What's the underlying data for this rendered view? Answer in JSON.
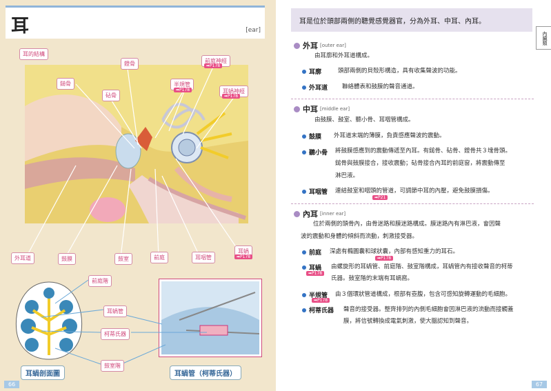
{
  "left": {
    "title": "耳",
    "title_en": "[ear]",
    "structure_title": "耳的結構",
    "labels": {
      "stapes": "鐙骨",
      "vestibular_nerve": "前庭神經",
      "vestibular_ref": "➡P178",
      "hammer": "鎚骨",
      "semicircular": "半規管",
      "semicircular_ref": "➡P178",
      "incus": "砧骨",
      "cochlear_nerve": "耳蝸神經",
      "cochlear_nerve_ref": "➡P178",
      "outer_canal": "外耳道",
      "eardrum": "鼓膜",
      "tympanic": "鼓室",
      "vestibule": "前庭",
      "eustachian": "耳咽管",
      "cochlea": "耳蝸",
      "cochlea_ref": "➡P178",
      "scala_vestibuli": "前庭階",
      "cochlear_duct": "耳蝸管",
      "corti": "柯蒂氏器",
      "scala_tympani": "鼓室階"
    },
    "captions": {
      "section": "耳蝸剖面圖",
      "duct": "耳蝸管（柯蒂氏器）"
    },
    "page": "66"
  },
  "right": {
    "intro": "耳是位於頭部兩側的聽覺感覺器官，分為外耳、中耳、內耳。",
    "side_tab": "內臟類",
    "outer": {
      "title": "外耳",
      "en": "[outer ear]",
      "summary": "由耳廓和外耳道構成。",
      "t1": "耳廓",
      "d1": "頭部兩側的貝殼形構造，具有收集聲波的功能。",
      "t2": "外耳道",
      "d2": "聯絡體表和鼓膜的聲音通道。"
    },
    "middle": {
      "title": "中耳",
      "en": "[middle ear]",
      "summary": "由鼓膜、鼓室、聽小骨、耳咽管構成。",
      "t1": "鼓膜",
      "d1": "外耳道末端的薄膜，負責感應聲波的震動。",
      "t2": "聽小骨",
      "d2a": "將鼓膜感應到的震動傳遞至內耳。有鎚骨、砧骨、鐙骨共３塊骨頭。",
      "d2b": "鎚骨與鼓膜接合，接收震動；砧骨接合內耳的前庭窗，將震動傳至",
      "d2c": "淋巴液。",
      "t3": "耳咽管",
      "d3": "連結鼓室和咽頭的管道，可調節中耳的內壓，避免鼓膜損傷。",
      "ref": "➡P21"
    },
    "inner": {
      "title": "內耳",
      "en": "[inner ear]",
      "summary1": "位於兩側的頭骨內，由骨迷路和膜迷路構成。膜迷路內有淋巴液，會因聲",
      "summary2": "波的震動和身體的傾斜而流動，刺激接受器。",
      "t1": "前庭",
      "d1": "深處有橢圓囊和球狀囊，內部有感知重力的耳石。",
      "ref1": "➡P178",
      "t2": "耳蝸",
      "ref2": "➡P178",
      "d2a": "由螺旋形的耳蝸管、前庭階、鼓室階構成，耳蝸管內有接收聲音的柯蒂",
      "d2b": "氏器。鼓室階的末端有耳蝸窩。",
      "t3": "半規管",
      "ref3": "➡P178",
      "d3": "由３個環狀管道構成，根部有壺腹，包含可感知旋轉運動的毛細胞。",
      "t4": "柯蒂氏器",
      "d4a": "聲音的接受器。整齊排列的內側毛細胞會因淋巴液的流動而接觸蓋",
      "d4b": "膜，將信號轉換成電氣刺激，使大腦認知到聲音。"
    },
    "page": "67"
  }
}
